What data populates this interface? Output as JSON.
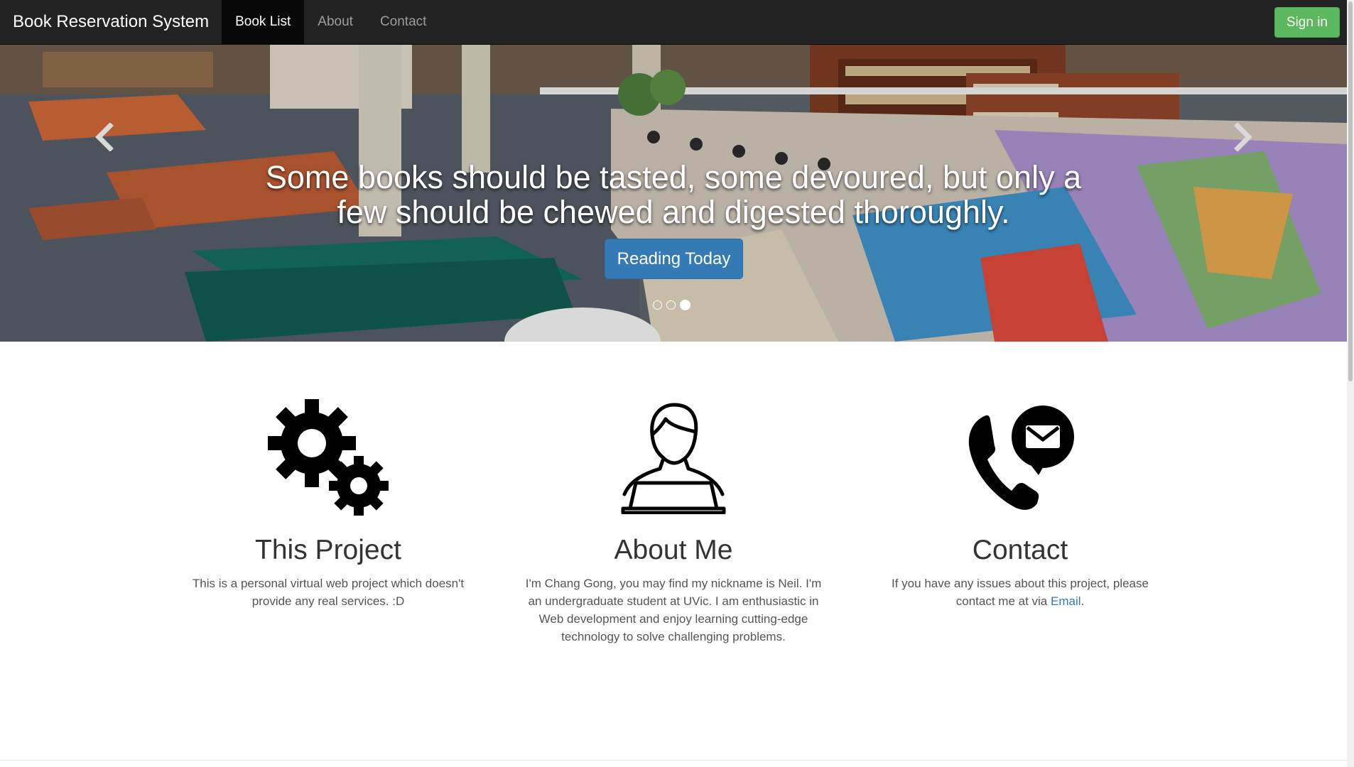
{
  "navbar": {
    "brand": "Book Reservation System",
    "items": [
      {
        "label": "Book List",
        "active": true
      },
      {
        "label": "About",
        "active": false
      },
      {
        "label": "Contact",
        "active": false
      }
    ],
    "signin_label": "Sign in"
  },
  "carousel": {
    "caption": "Some books should be tasted, some devoured, but only a few should be chewed and digested thoroughly.",
    "button_label": "Reading Today",
    "slides_count": 3,
    "active_slide": 3,
    "prev_icon": "chevron-left-icon",
    "next_icon": "chevron-right-icon"
  },
  "features": [
    {
      "icon": "gears-icon",
      "title": "This Project",
      "text": "This is a personal virtual web project which doesn't provide any real services. :D"
    },
    {
      "icon": "person-laptop-icon",
      "title": "About Me",
      "text": "I'm Chang Gong, you may find my nickname is Neil. I'm an undergraduate student at UVic. I am enthusiastic in Web development and enjoy learning cutting-edge technology to solve challenging problems."
    },
    {
      "icon": "phone-mail-icon",
      "title": "Contact",
      "text_before": "If you have any issues about this project, please contact me at via ",
      "link_label": "Email",
      "text_after": "."
    }
  ],
  "colors": {
    "navbar_bg": "#222222",
    "signin_bg": "#5cb85c",
    "primary": "#337ab7",
    "link": "#337ab7"
  }
}
